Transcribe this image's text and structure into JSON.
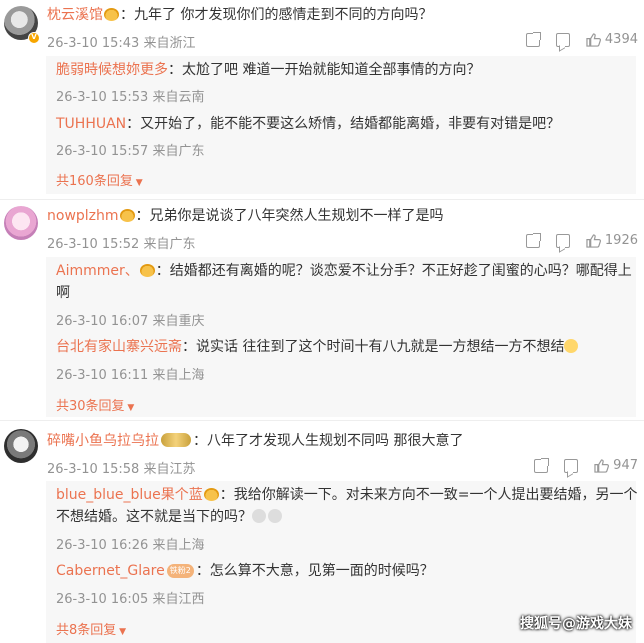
{
  "comments": [
    {
      "user": "枕云溪馆",
      "text": "：九年了 你才发现你们的感情走到不同的方向吗？",
      "meta": "26-3-10 15:43 来自浙江",
      "likes": "4394",
      "replies": [
        {
          "user": "脆弱時候想妳更多",
          "text": "：太尬了吧 难道一开始就能知道全部事情的方向？",
          "meta": "26-3-10 15:53 来自云南"
        },
        {
          "user": "TUHHUAN",
          "text": "：又开始了，能不能不要这么矫情，结婚都能离婚，非要有对错是吧？",
          "meta": "26-3-10 15:57 来自广东"
        }
      ],
      "more": "共160条回复"
    },
    {
      "user": "nowplzhm",
      "text": "：兄弟你是说谈了八年突然人生规划不一样了是吗",
      "meta": "26-3-10 15:52 来自广东",
      "likes": "1926",
      "replies": [
        {
          "user": "Aimmmer、",
          "text": "：结婚都还有离婚的呢？谈恋爱不让分手？不正好趁了闺蜜的心吗？哪配得上",
          "text2": "啊",
          "meta": "26-3-10 16:07 来自重庆"
        },
        {
          "user": "台北有家山寨兴远斋",
          "text": "：说实话 往往到了这个时间十有八九就是一方想结一方不想结",
          "meta": "26-3-10 16:11 来自上海"
        }
      ],
      "more": "共30条回复"
    },
    {
      "user": "碎嘴小鱼乌拉乌拉",
      "text": "：八年了才发现人生规划不同吗 那很大意了",
      "meta": "26-3-10 15:58 来自江苏",
      "likes": "947",
      "replies": [
        {
          "user": "blue_blue_blue果个蓝",
          "text": "：我给你解读一下。对未来方向不一致=一个人提出要结婚，另一个",
          "text2": "不想结婚。这不就是当下的吗？",
          "meta": "26-3-10 16:26 来自上海"
        },
        {
          "user": "Cabernet_Glare",
          "tag": "铁粉2",
          "text": "：怎么算不大意，见第一面的时候吗？",
          "meta": "26-3-10 16:05 来自江西"
        }
      ],
      "more": "共8条回复"
    }
  ],
  "watermark": "搜狐号@游戏大妹",
  "colors": {
    "username": "#eb7350",
    "meta": "#939393",
    "reply_bg": "#f7f7f7"
  }
}
